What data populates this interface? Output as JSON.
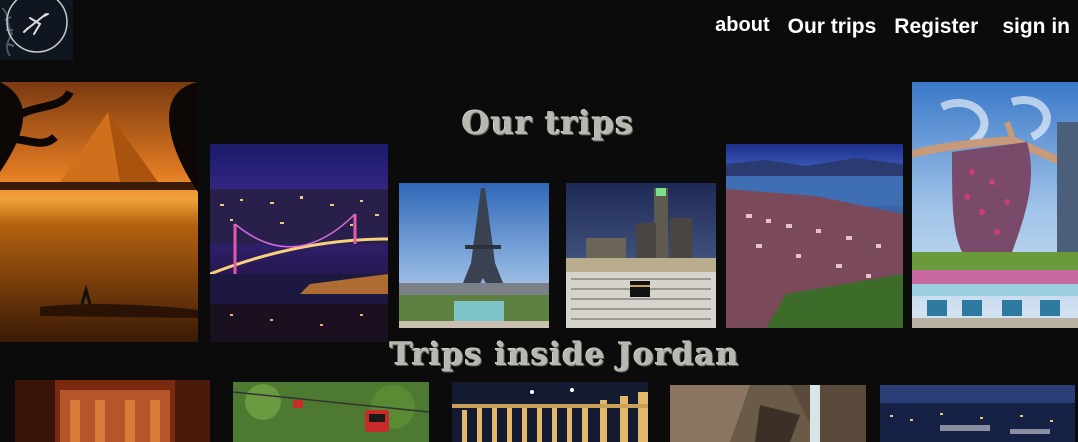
{
  "nav": {
    "about": "about",
    "our_trips": "Our trips",
    "register": "Register",
    "sign_in": "sign in"
  },
  "sections": {
    "our_trips_title": "Our trips",
    "jordan_title": "Trips inside Jordan"
  },
  "icons": {
    "logo": "airplane-icon"
  }
}
